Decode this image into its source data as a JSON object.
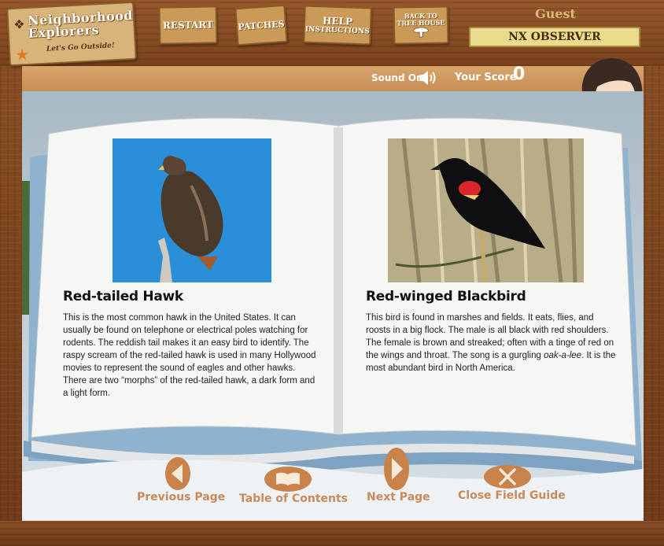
{
  "header": {
    "logo": {
      "title": "Neighborhood Explorers",
      "tagline": "Let's Go Outside!"
    },
    "nav_buttons": {
      "restart": "RESTART",
      "patches": "PATCHES",
      "help_line1": "HELP",
      "help_line2": "INSTRUCTIONS",
      "tree_line1": "BACK TO",
      "tree_line2": "TREE HOUSE"
    },
    "user": "Guest",
    "role": "NX OBSERVER"
  },
  "status": {
    "sound_label": "Sound On",
    "score_label": "Your Score",
    "score_value": "0"
  },
  "book": {
    "left": {
      "title": "Red-tailed Hawk",
      "text": "This is the most common hawk in the United States.  It can usually be found on telephone or electrical poles watching for rodents.  The reddish tail makes it an easy bird to identify.  The raspy scream of the red-tailed hawk is used in many Hollywood movies to represent the sound of eagles and other hawks.  There are two “morphs” of the red-tailed hawk, a dark form and a light form."
    },
    "right": {
      "title": "Red-winged Blackbird",
      "text_before": "This bird is found in marshes and fields.  It eats, flies, and roosts in a big flock.  The male is all black with red shoulders.  The female is brown and streaked; often with a tinge of red on the wings and throat.  The song is a gurgling ",
      "text_italic": "oak-a-lee",
      "text_after": ".  It is the most abundant bird in North America."
    }
  },
  "footer_nav": {
    "previous": "Previous Page",
    "toc": "Table of Contents",
    "next": "Next Page",
    "close": "Close Field Guide"
  },
  "colors": {
    "wood": "#7a421d",
    "nav_label": "#c88a5a",
    "nav_icon": "#c8824a",
    "observer_bg": "#e9dc8d"
  }
}
